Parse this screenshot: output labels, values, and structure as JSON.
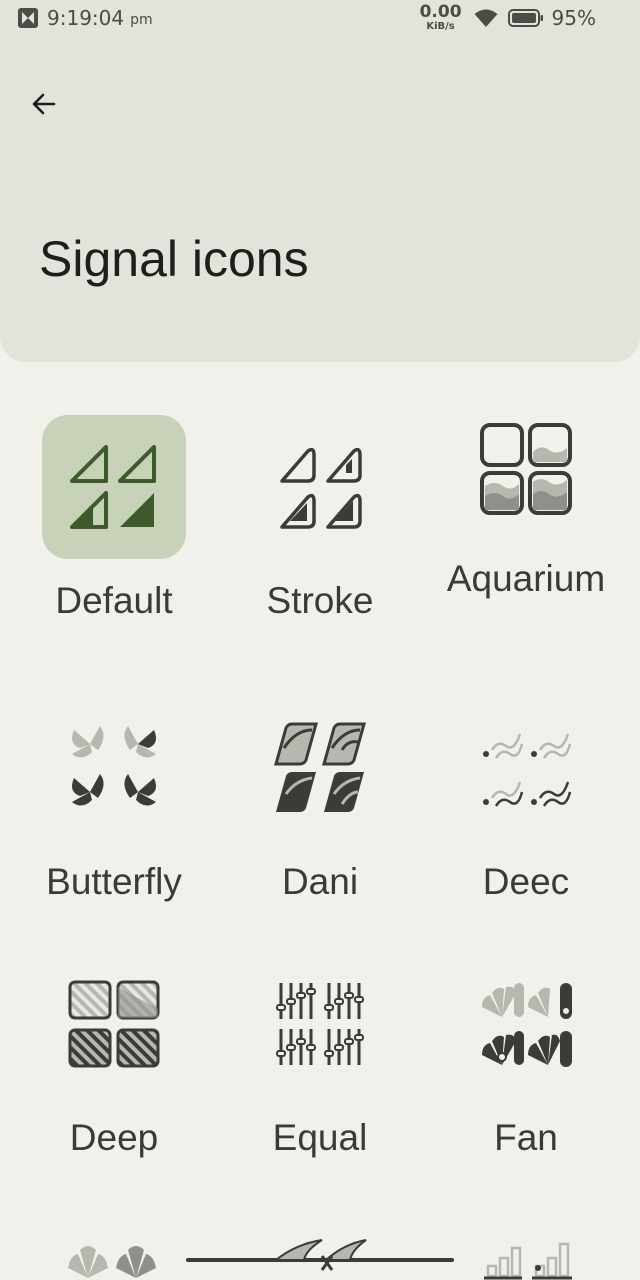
{
  "status_bar": {
    "time": "9:19:04",
    "ampm": "pm",
    "speed_value": "0.00",
    "speed_unit": "KiB/s",
    "battery_percent": "95%"
  },
  "header": {
    "title": "Signal icons",
    "back_icon": "arrow-left-icon"
  },
  "colors": {
    "selected_bg": "#c7d2b8",
    "accent_green": "#3d5a2a",
    "icon_dark": "#3b3c37",
    "icon_light": "#b7b7b0"
  },
  "icon_packs": [
    {
      "label": "Default",
      "selected": true
    },
    {
      "label": "Stroke"
    },
    {
      "label": "Aquarium"
    },
    {
      "label": "Butterfly"
    },
    {
      "label": "Dani"
    },
    {
      "label": "Deec"
    },
    {
      "label": "Deep"
    },
    {
      "label": "Equal"
    },
    {
      "label": "Fan"
    }
  ]
}
